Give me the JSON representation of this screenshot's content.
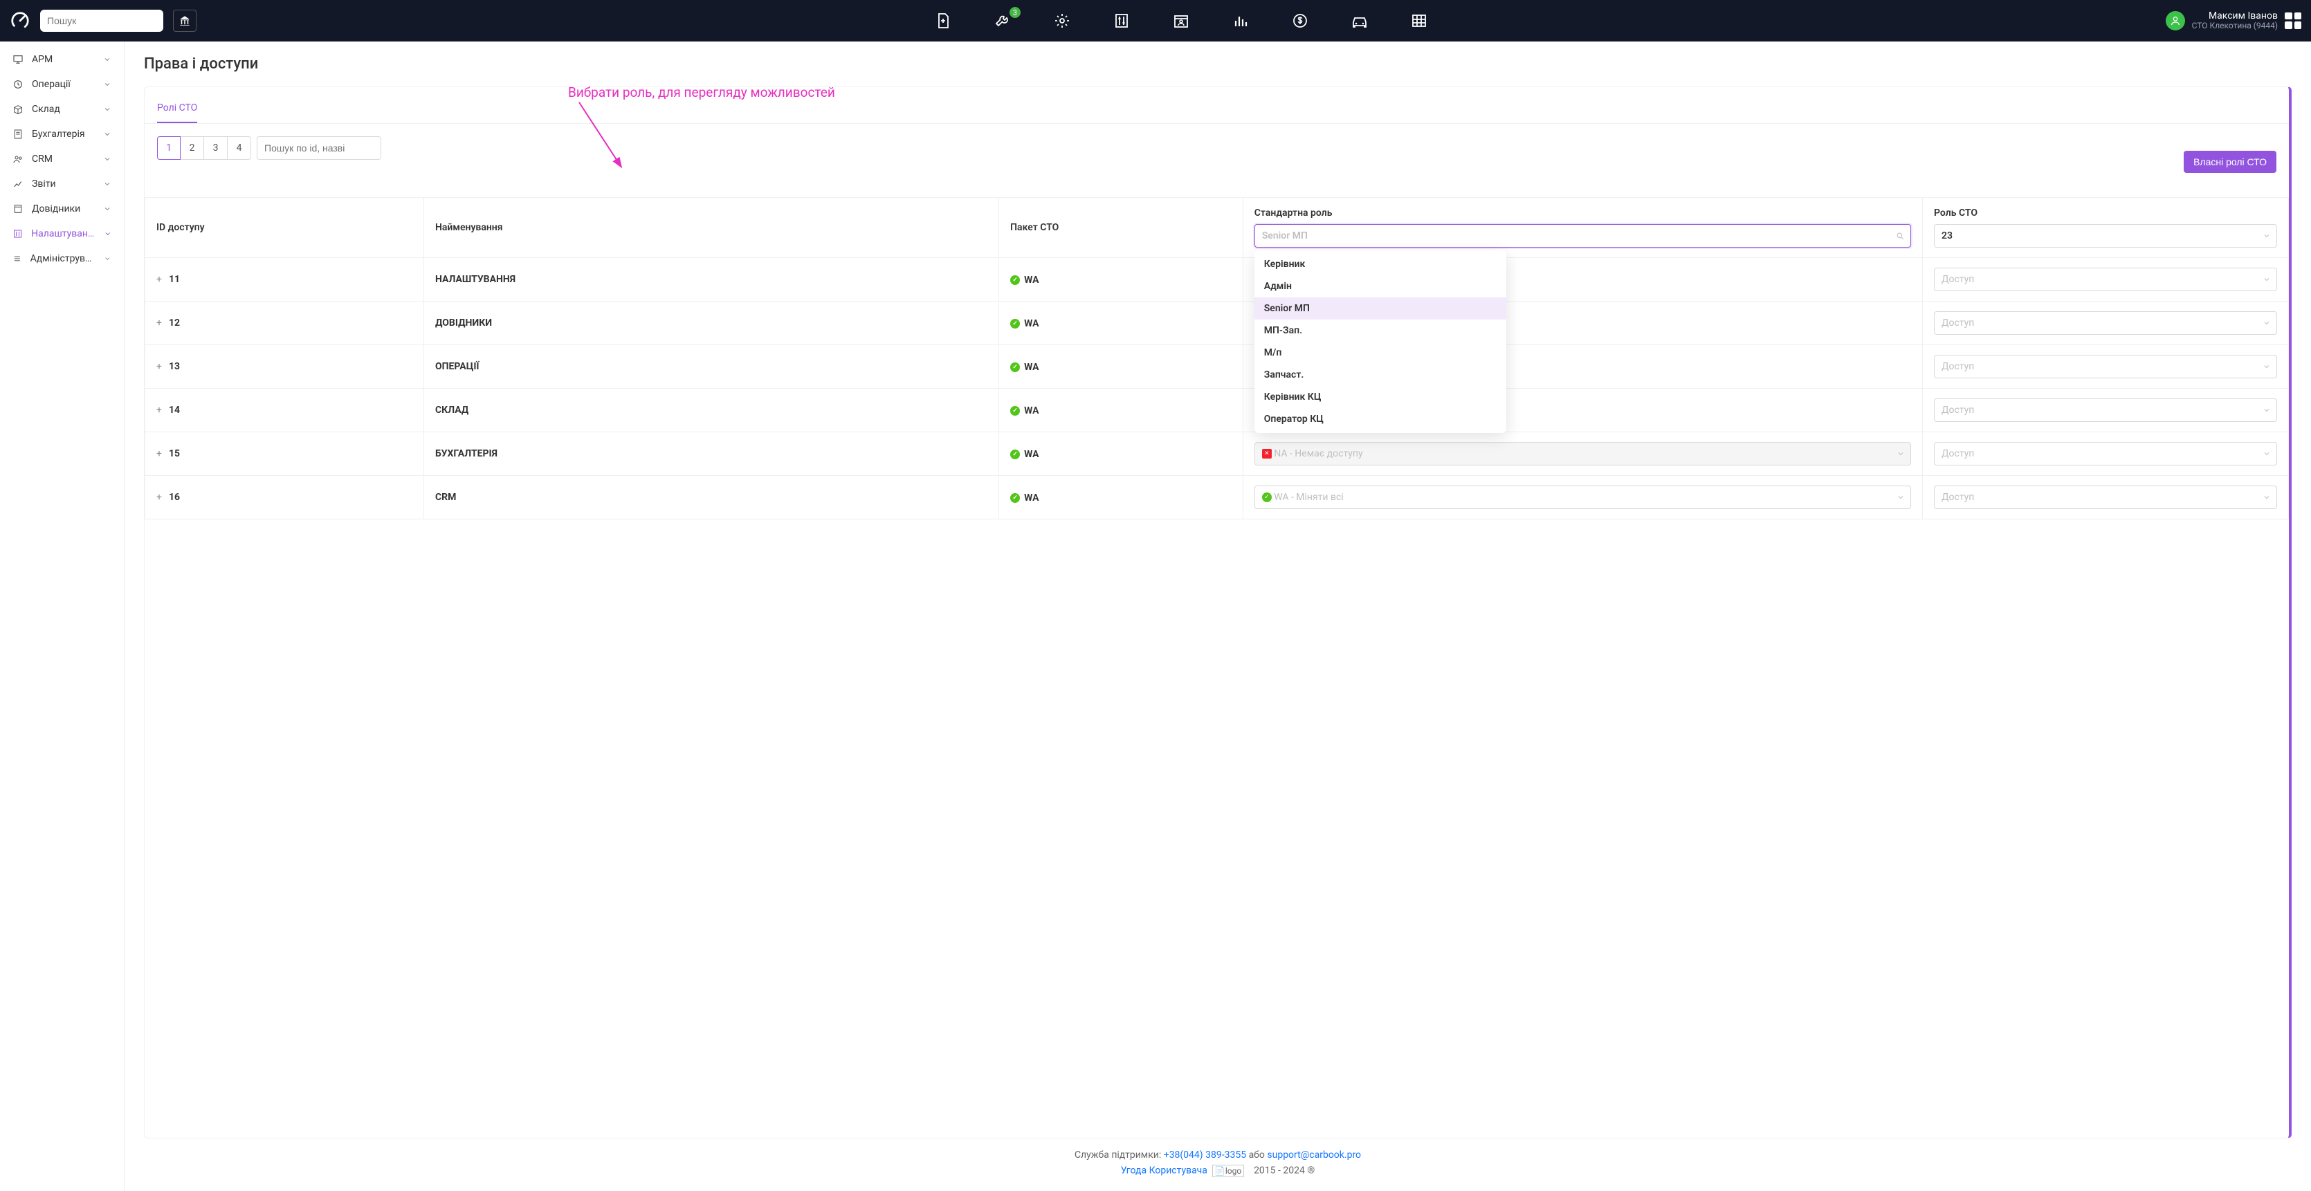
{
  "header": {
    "search_placeholder": "Пошук",
    "wrench_badge": "3",
    "user_name": "Максим Іванов",
    "user_org": "СТО Клекотина (9444)"
  },
  "sidebar": {
    "items": [
      {
        "label": "АРМ"
      },
      {
        "label": "Операції"
      },
      {
        "label": "Склад"
      },
      {
        "label": "Бухгалтерія"
      },
      {
        "label": "CRM"
      },
      {
        "label": "Звіти"
      },
      {
        "label": "Довідники"
      },
      {
        "label": "Налаштування"
      },
      {
        "label": "Адміністрування"
      }
    ]
  },
  "page": {
    "title": "Права і доступи",
    "tab": "Ролі СТО",
    "pages": [
      "1",
      "2",
      "3",
      "4"
    ],
    "id_search_placeholder": "Пошук по id, назві",
    "own_roles_btn": "Власні ролі СТО"
  },
  "annotation": "Вибрати роль, для перегляду можливостей",
  "table": {
    "headers": {
      "id": "ID доступу",
      "name": "Найменування",
      "pkg": "Пакет СТО",
      "std_role": "Стандартна роль",
      "sto_role": "Роль СТО"
    },
    "std_role_search_placeholder": "Senior МП",
    "sto_role_value": "23",
    "access_placeholder": "Доступ",
    "na_text": "NA - Немає доступу",
    "wa_text": "WA - Міняти всі",
    "rows": [
      {
        "id": "11",
        "name": "НАЛАШТУВАННЯ",
        "pkg": "WA"
      },
      {
        "id": "12",
        "name": "ДОВІДНИКИ",
        "pkg": "WA"
      },
      {
        "id": "13",
        "name": "ОПЕРАЦІЇ",
        "pkg": "WA"
      },
      {
        "id": "14",
        "name": "СКЛАД",
        "pkg": "WA"
      },
      {
        "id": "15",
        "name": "БУХГАЛТЕРІЯ",
        "pkg": "WA"
      },
      {
        "id": "16",
        "name": "CRM",
        "pkg": "WA"
      }
    ],
    "std_role_options": [
      "Керівник",
      "Адмін",
      "Senior МП",
      "МП-Зап.",
      "М/п",
      "Запчаст.",
      "Керівник КЦ",
      "Оператор КЦ"
    ]
  },
  "footer": {
    "support_label": "Служба підтримки: ",
    "phone": "+38(044) 389-3355",
    "or": " або ",
    "email": "support@carbook.pro",
    "agreement": "Угода Користувача",
    "logo_alt": "logo",
    "copyright": "2015 - 2024 ®"
  }
}
